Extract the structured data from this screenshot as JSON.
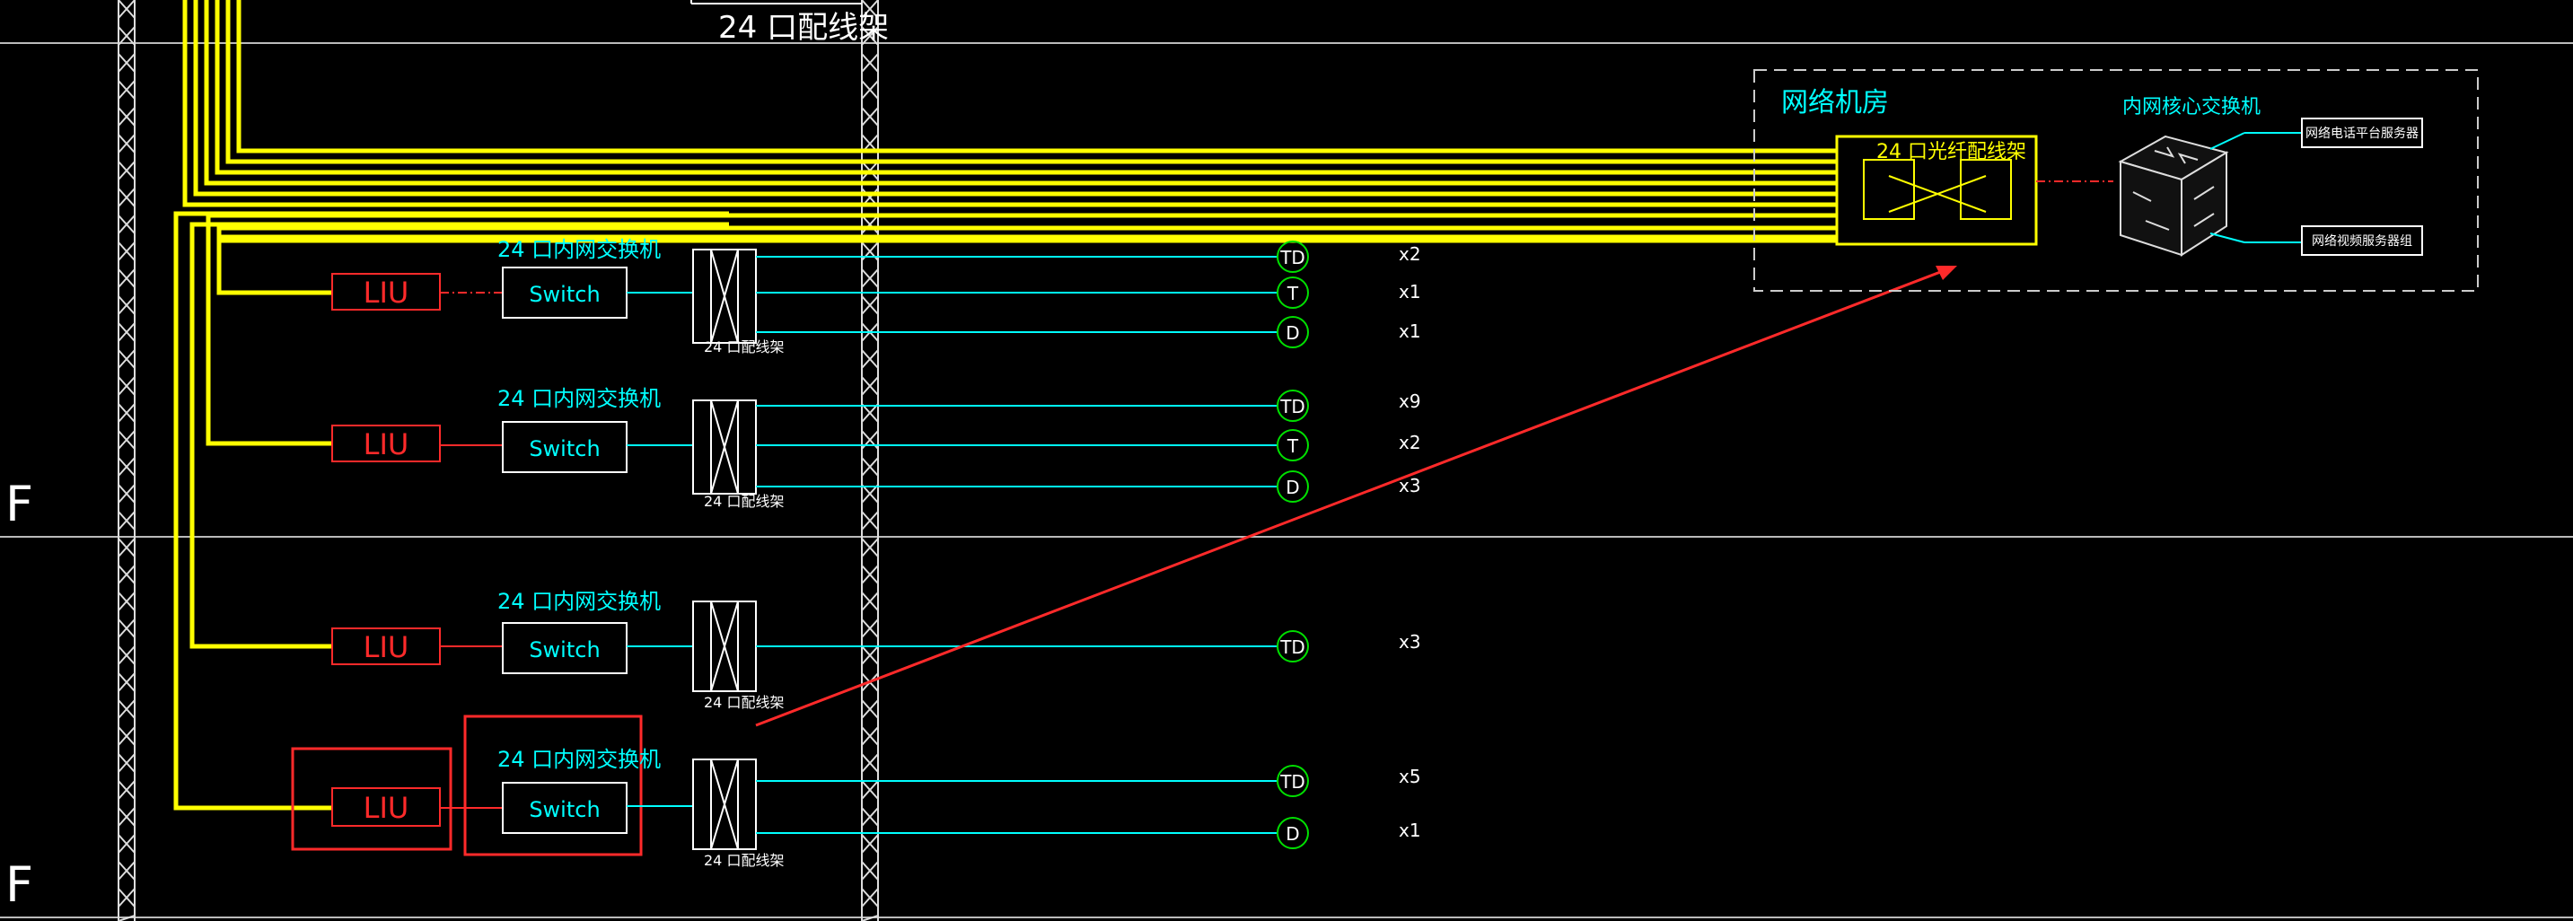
{
  "top_label": "24 口配线架",
  "floor_labels": [
    "F",
    "F"
  ],
  "rows": [
    {
      "liu": "LIU",
      "switch": "Switch",
      "switch_caption": "24 口内网交换机",
      "patch_caption": "24 口配线架",
      "outlets": [
        {
          "label": "TD",
          "count": "x2"
        },
        {
          "label": "T",
          "count": "x1"
        },
        {
          "label": "D",
          "count": "x1"
        }
      ]
    },
    {
      "liu": "LIU",
      "switch": "Switch",
      "switch_caption": "24 口内网交换机",
      "patch_caption": "24 口配线架",
      "outlets": [
        {
          "label": "TD",
          "count": "x9"
        },
        {
          "label": "T",
          "count": "x2"
        },
        {
          "label": "D",
          "count": "x3"
        }
      ]
    },
    {
      "liu": "LIU",
      "switch": "Switch",
      "switch_caption": "24 口内网交换机",
      "patch_caption": "24 口配线架",
      "outlets": [
        {
          "label": "TD",
          "count": "x3"
        }
      ]
    },
    {
      "liu": "LIU",
      "switch": "Switch",
      "switch_caption": "24 口内网交换机",
      "patch_caption": "24 口配线架",
      "outlets": [
        {
          "label": "TD",
          "count": "x5"
        },
        {
          "label": "D",
          "count": "x1"
        }
      ]
    }
  ],
  "network_room": {
    "title": "网络机房",
    "fiber_panel": "24 口光纤配线架",
    "core_switch": "内网核心交换机",
    "outputs": [
      "网络电话平台服务器",
      "网络视频服务器组"
    ]
  },
  "colors": {
    "cyan": "#00ffff",
    "yellow": "#ffff00",
    "red": "#ff2a2a",
    "green": "#00e000",
    "white": "#ffffff"
  }
}
